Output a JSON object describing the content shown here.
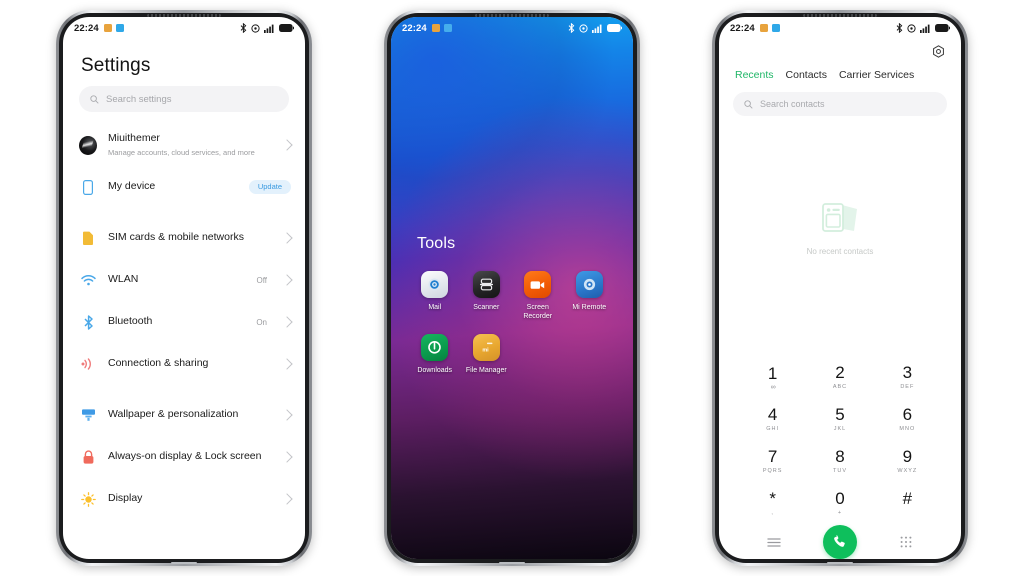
{
  "statusbar": {
    "time": "22:24",
    "notification_icons": [
      "orange-notification-icon",
      "blue-notification-icon"
    ],
    "notification_colors": [
      "#e8a33d",
      "#2fa8e8"
    ],
    "system_icons": [
      "bluetooth-icon",
      "alarm-icon",
      "signal-icon",
      "battery-icon"
    ]
  },
  "settings_phone": {
    "title": "Settings",
    "search": {
      "placeholder": "Search settings",
      "icon": "search-icon"
    },
    "groups": [
      {
        "items": [
          {
            "label": "Miuithemer",
            "sub": "Manage accounts, cloud services, and more",
            "icon": "account-avatar",
            "value": "",
            "badge": "",
            "chevron": true
          },
          {
            "label": "My device",
            "sub": "",
            "icon": "phone-outline-icon",
            "value": "",
            "badge": "Update",
            "chevron": false
          }
        ]
      },
      {
        "items": [
          {
            "label": "SIM cards & mobile networks",
            "sub": "",
            "icon": "sim-card-icon",
            "value": "",
            "badge": "",
            "chevron": true
          },
          {
            "label": "WLAN",
            "sub": "",
            "icon": "wifi-icon",
            "value": "Off",
            "badge": "",
            "chevron": true
          },
          {
            "label": "Bluetooth",
            "sub": "",
            "icon": "bluetooth-icon",
            "value": "On",
            "badge": "",
            "chevron": true
          },
          {
            "label": "Connection & sharing",
            "sub": "",
            "icon": "connection-sharing-icon",
            "value": "",
            "badge": "",
            "chevron": true
          }
        ]
      },
      {
        "items": [
          {
            "label": "Wallpaper & personalization",
            "sub": "",
            "icon": "wallpaper-icon",
            "value": "",
            "badge": "",
            "chevron": true
          },
          {
            "label": "Always-on display & Lock screen",
            "sub": "",
            "icon": "lock-icon",
            "value": "",
            "badge": "",
            "chevron": true
          },
          {
            "label": "Display",
            "sub": "",
            "icon": "display-brightness-icon",
            "value": "",
            "badge": "",
            "chevron": true
          }
        ]
      }
    ]
  },
  "home_phone": {
    "folder_title": "Tools",
    "apps": [
      {
        "name": "Mail",
        "icon": "mail-app-icon"
      },
      {
        "name": "Scanner",
        "icon": "scanner-app-icon"
      },
      {
        "name": "Screen Recorder",
        "icon": "screen-recorder-app-icon"
      },
      {
        "name": "Mi Remote",
        "icon": "mi-remote-app-icon"
      },
      {
        "name": "Downloads",
        "icon": "downloads-app-icon"
      },
      {
        "name": "File Manager",
        "icon": "file-manager-app-icon"
      }
    ]
  },
  "dialer_phone": {
    "settings_icon": "gear-icon",
    "tabs": [
      {
        "label": "Recents",
        "active": true
      },
      {
        "label": "Contacts",
        "active": false
      },
      {
        "label": "Carrier Services",
        "active": false
      }
    ],
    "search": {
      "placeholder": "Search contacts",
      "icon": "search-icon"
    },
    "empty_state": {
      "text": "No recent contacts",
      "icon": "contact-cards-illustration"
    },
    "keypad": [
      {
        "num": "1",
        "sub": "",
        "voicemail": true
      },
      {
        "num": "2",
        "sub": "ABC",
        "voicemail": false
      },
      {
        "num": "3",
        "sub": "DEF",
        "voicemail": false
      },
      {
        "num": "4",
        "sub": "GHI",
        "voicemail": false
      },
      {
        "num": "5",
        "sub": "JKL",
        "voicemail": false
      },
      {
        "num": "6",
        "sub": "MNO",
        "voicemail": false
      },
      {
        "num": "7",
        "sub": "PQRS",
        "voicemail": false
      },
      {
        "num": "8",
        "sub": "TUV",
        "voicemail": false
      },
      {
        "num": "9",
        "sub": "WXYZ",
        "voicemail": false
      },
      {
        "num": "*",
        "sub": ",",
        "voicemail": false
      },
      {
        "num": "0",
        "sub": "+",
        "voicemail": false
      },
      {
        "num": "#",
        "sub": "",
        "voicemail": false
      }
    ],
    "actions": {
      "menu_icon": "menu-icon",
      "call_icon": "call-handset-icon",
      "dialpad_icon": "dialpad-grid-icon"
    },
    "accent_color": "#0ebf5c"
  }
}
